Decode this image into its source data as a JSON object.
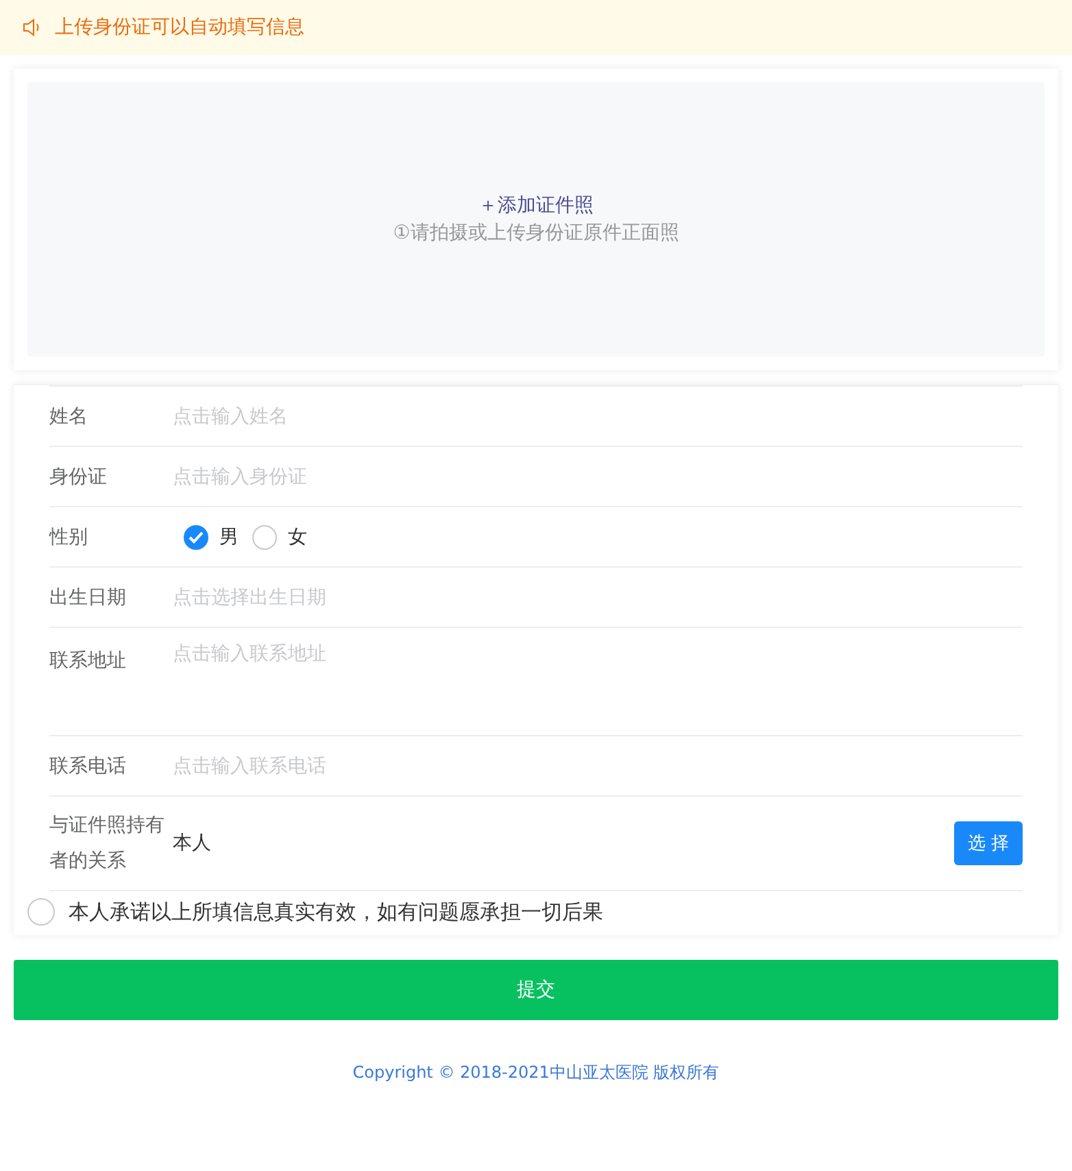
{
  "notice": {
    "text": "上传身份证可以自动填写信息"
  },
  "upload": {
    "action": "＋添加证件照",
    "hint": "①请拍摄或上传身份证原件正面照"
  },
  "form": {
    "rows": [
      {
        "kind": "input",
        "label": "姓名",
        "placeholder": "点击输入姓名"
      },
      {
        "kind": "input",
        "label": "身份证",
        "placeholder": "点击输入身份证"
      },
      {
        "kind": "radio",
        "label": "性别",
        "options": [
          {
            "label": "男",
            "selected": true
          },
          {
            "label": "女",
            "selected": false
          }
        ]
      },
      {
        "kind": "input",
        "label": "出生日期",
        "placeholder": "点击选择出生日期"
      },
      {
        "kind": "textarea",
        "label": "联系地址",
        "placeholder": "点击输入联系地址"
      },
      {
        "kind": "input",
        "label": "联系电话",
        "placeholder": "点击输入联系电话"
      },
      {
        "kind": "select",
        "label": "与证件照持有者的关系",
        "value": "本人",
        "button": "选 择"
      }
    ],
    "agreement": {
      "text": "本人承诺以上所填信息真实有效，如有问题愿承担一切后果",
      "checked": false
    }
  },
  "submit": "提交",
  "footer": "Copyright © 2018-2021中山亚太医院 版权所有"
}
